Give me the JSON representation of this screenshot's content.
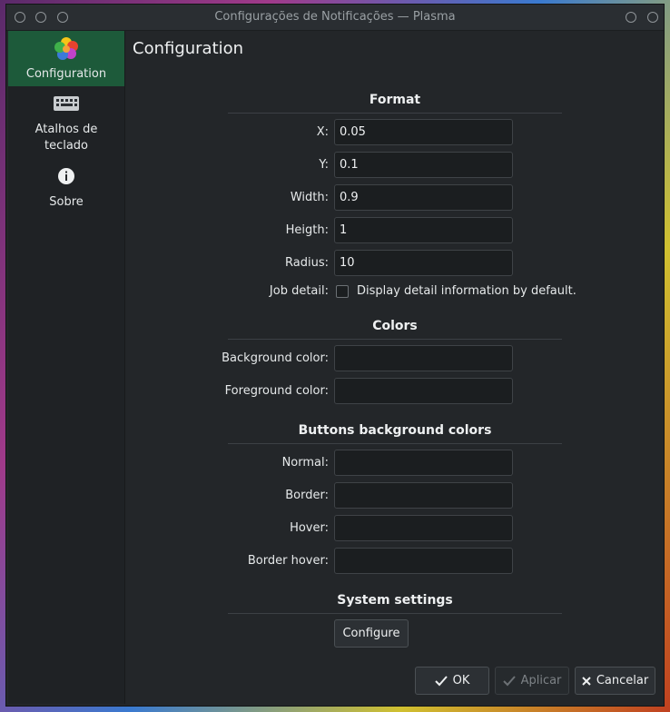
{
  "window": {
    "title": "Configurações de Notificações — Plasma"
  },
  "sidebar": {
    "items": [
      {
        "label": "Configuration",
        "icon": "flower-icon"
      },
      {
        "label": "Atalhos de teclado",
        "icon": "keyboard-icon"
      },
      {
        "label": "Sobre",
        "icon": "info-icon"
      }
    ]
  },
  "page": {
    "title": "Configuration"
  },
  "format": {
    "title": "Format",
    "x_label": "X:",
    "x_value": "0.05",
    "y_label": "Y:",
    "y_value": "0.1",
    "width_label": "Width:",
    "width_value": "0.9",
    "height_label": "Heigth:",
    "height_value": "1",
    "radius_label": "Radius:",
    "radius_value": "10",
    "job_detail_label": "Job detail:",
    "job_detail_checkbox_label": "Display detail information by default.",
    "job_detail_checked": false
  },
  "colors": {
    "title": "Colors",
    "background_label": "Background color:",
    "background_value": "",
    "foreground_label": "Foreground color:",
    "foreground_value": ""
  },
  "buttons_colors": {
    "title": "Buttons background colors",
    "normal_label": "Normal:",
    "normal_value": "",
    "border_label": "Border:",
    "border_value": "",
    "hover_label": "Hover:",
    "hover_value": "",
    "border_hover_label": "Border hover:",
    "border_hover_value": ""
  },
  "system_settings": {
    "title": "System settings",
    "configure_label": "Configure"
  },
  "dialog_buttons": {
    "ok_label": "OK",
    "apply_label": "Aplicar",
    "cancel_label": "Cancelar"
  },
  "colors_theme": {
    "accent": "#1d5a3a",
    "window_bg": "#232629",
    "input_bg": "#1b1e20"
  }
}
